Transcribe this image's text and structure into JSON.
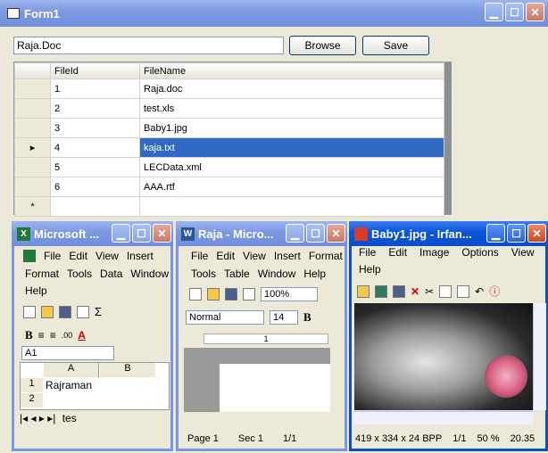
{
  "form1": {
    "title": "Form1",
    "path_value": "Raja.Doc",
    "browse_label": "Browse",
    "save_label": "Save",
    "grid": {
      "columns": [
        "FileId",
        "FileName"
      ],
      "rows": [
        {
          "id": "1",
          "name": "Raja.doc"
        },
        {
          "id": "2",
          "name": "test.xls"
        },
        {
          "id": "3",
          "name": "Baby1.jpg"
        },
        {
          "id": "4",
          "name": "kaja.txt"
        },
        {
          "id": "5",
          "name": "LECData.xml"
        },
        {
          "id": "6",
          "name": "AAA.rtf"
        }
      ],
      "new_row_marker": "*"
    }
  },
  "excel": {
    "title": "Microsoft ...",
    "menu1": [
      "File",
      "Edit",
      "View",
      "Insert"
    ],
    "menu2": [
      "Format",
      "Tools",
      "Data",
      "Window"
    ],
    "menu3": [
      "Help"
    ],
    "name_box": "A1",
    "col_a": "A",
    "col_b": "B",
    "row1": "1",
    "row2": "2",
    "cell_a1": "Rajraman",
    "sheet_tab": "tes",
    "bold": "B",
    "font_color": "A",
    "sigma": "Σ"
  },
  "word": {
    "title": "Raja - Micro...",
    "menu1": [
      "File",
      "Edit",
      "View",
      "Insert",
      "Format"
    ],
    "menu2": [
      "Tools",
      "Table",
      "Window",
      "Help"
    ],
    "zoom": "100%",
    "style": "Normal",
    "font_size": "14",
    "bold": "B",
    "status": [
      "Page 1",
      "Sec 1",
      "1/1"
    ],
    "ruler_mark": "1"
  },
  "irfan": {
    "title": "Baby1.jpg - Irfan...",
    "menu1": [
      "File",
      "Edit",
      "Image",
      "Options",
      "View"
    ],
    "menu2": [
      "Help"
    ],
    "status": [
      "419 x 334 x 24 BPP",
      "1/1",
      "50 %",
      "20.35"
    ]
  }
}
